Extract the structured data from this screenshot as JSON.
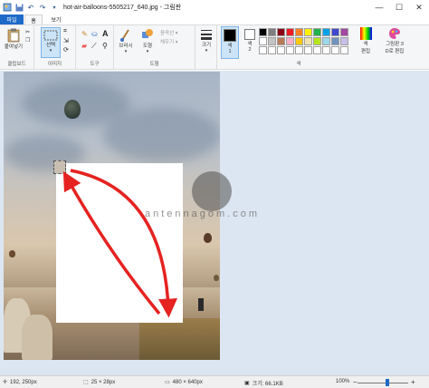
{
  "window": {
    "title": "hot-air-balloons-5505217_640.jpg - 그림판",
    "minimize": "—",
    "maximize": "☐",
    "close": "✕"
  },
  "tabs": {
    "file": "파일",
    "home": "홈",
    "view": "보기"
  },
  "ribbon": {
    "clipboard": {
      "paste": "붙여넣기",
      "label": "클립보드"
    },
    "image": {
      "select": "선택",
      "label": "이미지"
    },
    "tools": {
      "label": "도구"
    },
    "shapes": {
      "brushes": "브러시",
      "shapes_btn": "도형",
      "outline": "윤곽선",
      "fill": "채우기",
      "label": "도형"
    },
    "size": {
      "label": "크기"
    },
    "colors": {
      "color1": "색\n1",
      "color1_line1": "색",
      "color1_line2": "1",
      "color2_line1": "색",
      "color2_line2": "2",
      "edit_line1": "색",
      "edit_line2": "편집",
      "paint3d_line1": "그림판 3",
      "paint3d_line2": "D로 편집",
      "label": "색",
      "palette": [
        "#000000",
        "#7f7f7f",
        "#880015",
        "#ed1c24",
        "#ff7f27",
        "#fff200",
        "#22b14c",
        "#00a2e8",
        "#3f48cc",
        "#a349a4",
        "#ffffff",
        "#c3c3c3",
        "#b97a57",
        "#ffaec9",
        "#ffc90e",
        "#efe4b0",
        "#b5e61d",
        "#99d9ea",
        "#7092be",
        "#c8bfe7",
        "#ffffff",
        "#ffffff",
        "#ffffff",
        "#ffffff",
        "#ffffff",
        "#ffffff",
        "#ffffff",
        "#ffffff",
        "#ffffff",
        "#ffffff"
      ]
    }
  },
  "canvas": {
    "watermark": "antennagom.com",
    "arrow_color": "#e52321"
  },
  "status": {
    "cursor": "192, 250px",
    "selection": "25 × 28px",
    "image_size": "480 × 640px",
    "file_size": "크기: 66.1KB",
    "zoom": "100%",
    "zoom_out": "−",
    "zoom_in": "+"
  }
}
